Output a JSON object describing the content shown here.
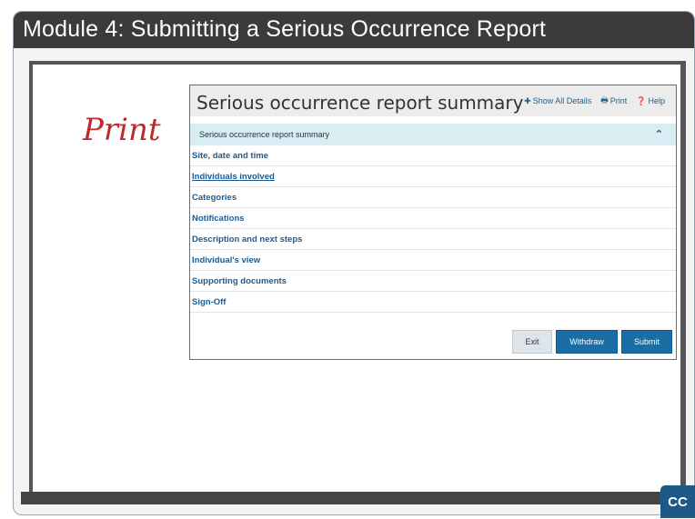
{
  "title": "Module 4:  Submitting a Serious Occurrence Report",
  "print_label": "Print",
  "panel": {
    "title": "Serious occurrence report summary",
    "actions": {
      "show_all": "Show All Details",
      "print": "Print",
      "help": "Help"
    },
    "accordion_label": "Serious occurrence report summary",
    "rows": [
      "Site, date and time",
      "Individuals involved",
      "Categories",
      "Notifications",
      "Description and next steps",
      "Individual's view",
      "Supporting documents",
      "Sign-Off"
    ],
    "buttons": {
      "exit": "Exit",
      "withdraw": "Withdraw",
      "submit": "Submit"
    }
  },
  "cc_label": "CC",
  "colors": {
    "title_bar": "#3b3b3b",
    "accent_blue": "#1a6ea3",
    "link_blue": "#1f5a8c",
    "print_red": "#c0282b",
    "accordion_bg": "#d8eef2"
  }
}
